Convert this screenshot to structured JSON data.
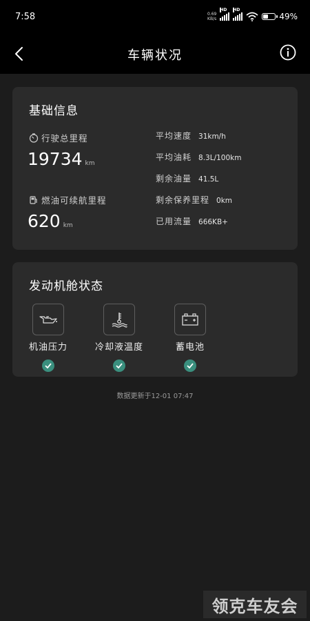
{
  "status_bar": {
    "time": "7:58",
    "net_speed_value": "0.69",
    "net_speed_unit": "KB/s",
    "signal1_label": "HD",
    "signal2_label": "HD",
    "battery_percent": 49,
    "battery_text": "49%"
  },
  "header": {
    "title": "车辆状况",
    "back_icon": "chevron-left-icon",
    "info_icon": "info-circle-icon"
  },
  "basic_info": {
    "title": "基础信息",
    "total_mileage": {
      "label": "行驶总里程",
      "value": "19734",
      "unit": "km"
    },
    "fuel_range": {
      "label": "燃油可续航里程",
      "value": "620",
      "unit": "km"
    },
    "rows": [
      {
        "label": "平均速度",
        "value": "31km/h"
      },
      {
        "label": "平均油耗",
        "value": "8.3L/100km"
      },
      {
        "label": "剩余油量",
        "value": "41.5L"
      },
      {
        "label": "剩余保养里程",
        "value": "0km"
      },
      {
        "label": "已用流量",
        "value": "666KB+"
      }
    ]
  },
  "engine": {
    "title": "发动机舱状态",
    "items": [
      {
        "label": "机油压力",
        "icon": "oil-can-icon",
        "status": "ok"
      },
      {
        "label": "冷却液温度",
        "icon": "coolant-temp-icon",
        "status": "ok"
      },
      {
        "label": "蓄电池",
        "icon": "battery-icon",
        "status": "ok"
      }
    ]
  },
  "footer": {
    "update_text": "数据更新于12-01 07:47"
  },
  "watermark": {
    "text": "领克车友会"
  },
  "colors": {
    "background": "#1c1c1c",
    "card": "#2b2b2b",
    "check_green": "#3a8f7e"
  }
}
